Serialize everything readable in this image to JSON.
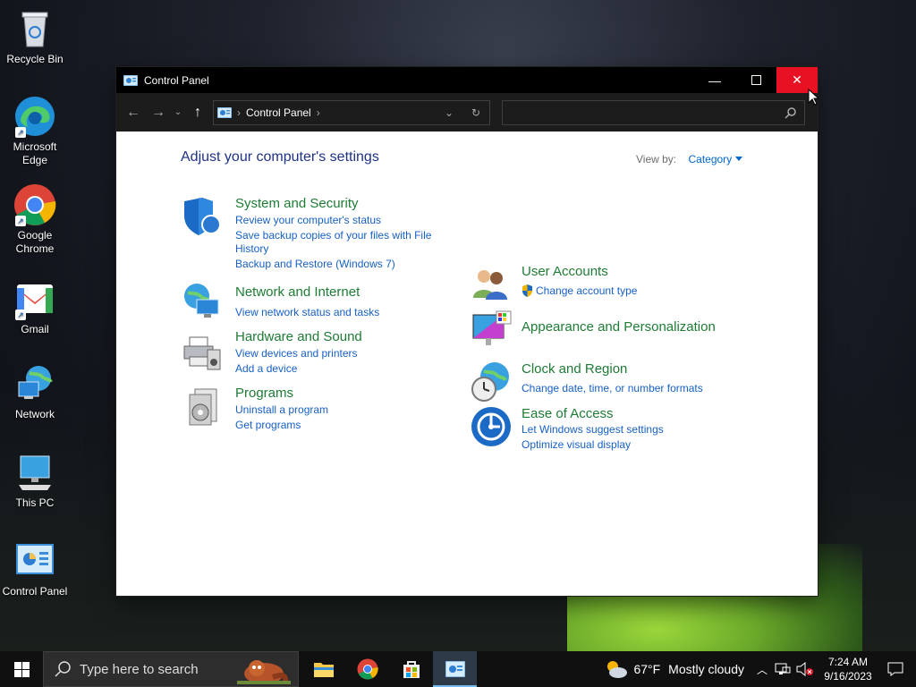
{
  "desktop": {
    "icons": [
      {
        "label": "Recycle Bin"
      },
      {
        "label": "Microsoft Edge"
      },
      {
        "label": "Google Chrome"
      },
      {
        "label": "Gmail"
      },
      {
        "label": "Network"
      },
      {
        "label": "This PC"
      },
      {
        "label": "Control Panel"
      }
    ]
  },
  "window": {
    "title": "Control Panel",
    "breadcrumb": "Control Panel",
    "search_placeholder": "",
    "heading": "Adjust your computer's settings",
    "view_by_label": "View by:",
    "view_by_value": "Category",
    "categories": [
      {
        "title": "System and Security",
        "links": [
          "Review your computer's status",
          "Save backup copies of your files with File",
          "History",
          "Backup and Restore (Windows 7)"
        ]
      },
      {
        "title": "Network and Internet",
        "links": [
          "View network status and tasks"
        ]
      },
      {
        "title": "Hardware and Sound",
        "links": [
          "View devices and printers",
          "Add a device"
        ]
      },
      {
        "title": "Programs",
        "links": [
          "Uninstall a program",
          "Get programs"
        ]
      },
      {
        "title": "User Accounts",
        "links": [
          "Change account type"
        ]
      },
      {
        "title": "Appearance and Personalization",
        "links": []
      },
      {
        "title": "Clock and Region",
        "links": [
          "Change date, time, or number formats"
        ]
      },
      {
        "title": "Ease of Access",
        "links": [
          "Let Windows suggest settings",
          "Optimize visual display"
        ]
      }
    ]
  },
  "taskbar": {
    "search_placeholder": "Type here to search",
    "weather": {
      "temp": "67°F",
      "condition": "Mostly cloudy"
    },
    "clock": {
      "time": "7:24 AM",
      "date": "9/16/2023"
    }
  },
  "colors": {
    "accent_close": "#e81123",
    "category_title": "#1e7c35",
    "link": "#1760c4",
    "heading": "#1e3287"
  }
}
